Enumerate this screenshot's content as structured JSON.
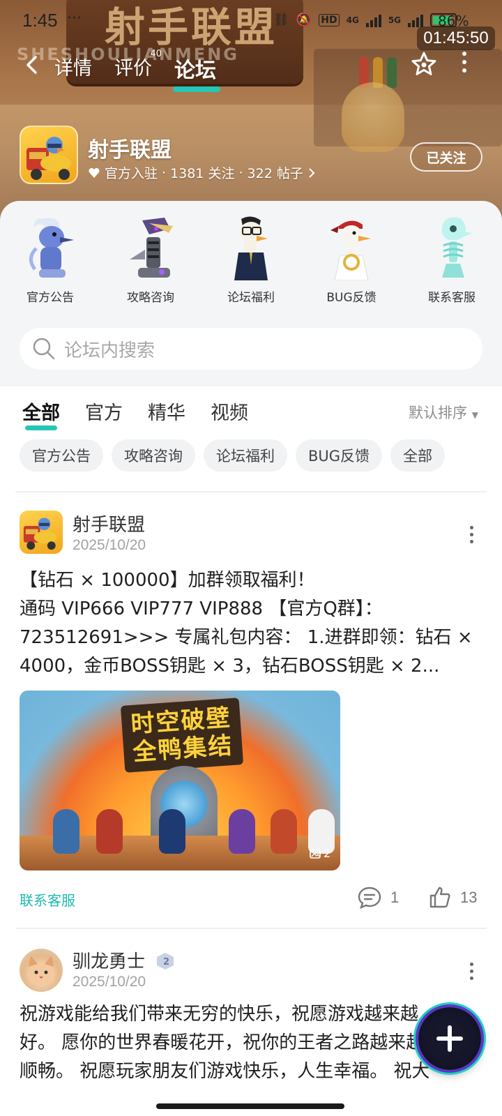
{
  "status_bar": {
    "time": "1:45",
    "dots": "···",
    "battery_pct": "86%",
    "network_a": "4G",
    "network_b": "5G",
    "hd": "HD"
  },
  "clock_overlay": "01:45:50",
  "hero": {
    "sign_text": "射手联盟",
    "sign_sub": "SHESHOULIANMENG"
  },
  "nav": {
    "tabs": [
      {
        "label": "详情",
        "badge": ""
      },
      {
        "label": "评价",
        "badge": "40"
      },
      {
        "label": "论坛",
        "badge": ""
      }
    ],
    "active_tab": "论坛"
  },
  "game": {
    "name": "射手联盟",
    "badge": "官方入驻",
    "followers": "1381 关注",
    "posts": "322 帖子",
    "sep": "·",
    "follow_label": "已关注"
  },
  "categories": [
    {
      "label": "官方公告",
      "icon": "ice-duck-icon"
    },
    {
      "label": "攻略咨询",
      "icon": "mech-duck-icon"
    },
    {
      "label": "论坛福利",
      "icon": "glasses-duck-icon"
    },
    {
      "label": "BUG反馈",
      "icon": "bandana-duck-icon"
    },
    {
      "label": "联系客服",
      "icon": "skeleton-duck-icon"
    }
  ],
  "search": {
    "placeholder": "论坛内搜索"
  },
  "feed_tabs": [
    "全部",
    "官方",
    "精华",
    "视频"
  ],
  "sort_label": "默认排序",
  "chips": [
    "官方公告",
    "攻略咨询",
    "论坛福利",
    "BUG反馈",
    "全部"
  ],
  "posts": [
    {
      "author": "射手联盟",
      "date": "2025/10/20",
      "lines": [
        "【钻石 × 100000】加群领取福利！",
        "通码 VIP666 VIP777 VIP888 【官方Q群】：",
        "723512691>>> 专属礼包内容： 1.进群即领：钻石 ×",
        "4000，金币BOSS钥匙 × 3，钻石BOSS钥匙 × 2..."
      ],
      "image_title_1": "时空破壁",
      "image_title_2": "全鸭集结",
      "image_count": "2",
      "tag": "联系客服",
      "comments": "1",
      "likes": "13"
    },
    {
      "author": "驯龙勇士",
      "date": "2025/10/20",
      "level": "2",
      "lines": [
        "祝游戏能给我们带来无穷的快乐，祝愿游戏越来越",
        "好。 愿你的世界春暖花开，祝你的王者之路越来越",
        "顺畅。 祝愿玩家朋友们游戏快乐，人生幸福。 祝大"
      ]
    }
  ],
  "colors": {
    "accent": "#25c6b6",
    "tag": "#20b9b0",
    "banner": "#a9754a"
  }
}
